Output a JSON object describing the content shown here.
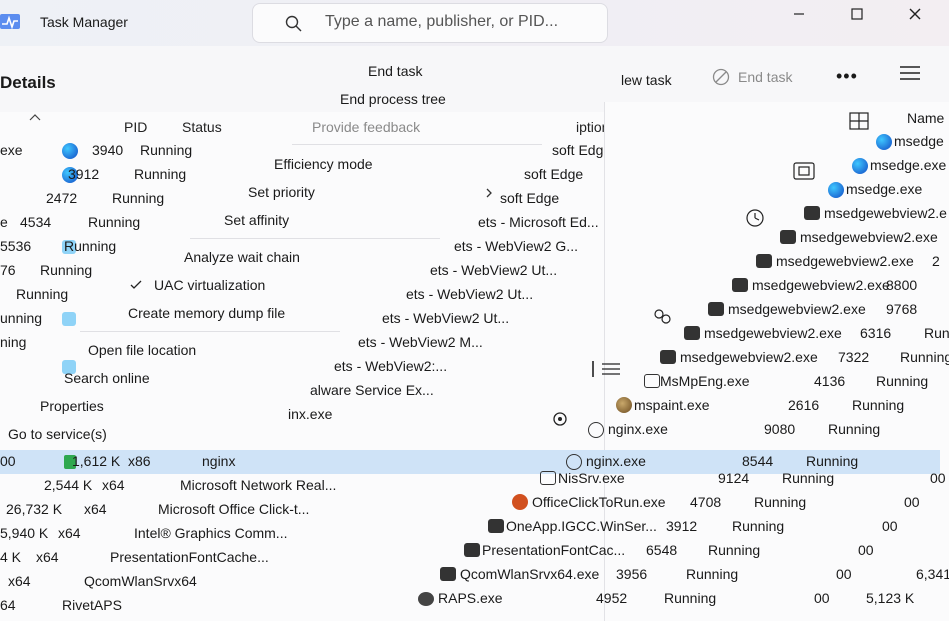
{
  "app": {
    "title": "Task Manager"
  },
  "search": {
    "placeholder": "Type a name, publisher, or PID..."
  },
  "window_controls": {
    "minimize": "—",
    "maximize": "☐",
    "close": "✕"
  },
  "commandbar": {
    "page_title": "Details",
    "run_new_task": "lew task",
    "end_task": "End task",
    "more": "•••"
  },
  "left_table": {
    "headers": {
      "pid": "PID",
      "status": "Status",
      "desc": "iption"
    },
    "rows": [
      {
        "name": "exe",
        "pid": "3940",
        "status": "Running",
        "desc": "soft Edge"
      },
      {
        "name": "",
        "pid": "3912",
        "status": "Running",
        "desc": "soft Edge"
      },
      {
        "name": "",
        "pid": "2472",
        "status": "Running",
        "desc": "soft Edge"
      },
      {
        "name": "e",
        "pid": "4534",
        "status": "Running",
        "desc": "ets - Microsoft Ed..."
      },
      {
        "name": "",
        "pid": "5536",
        "status": "Running",
        "desc": "ets - WebView2 G..."
      },
      {
        "name": "76",
        "pid": "",
        "status": "Running",
        "desc": "ets - WebView2 Ut..."
      },
      {
        "name": "",
        "pid": "",
        "status": "Running",
        "desc": "ets - WebView2 Ut..."
      },
      {
        "name": "",
        "pid": "",
        "status": "unning",
        "desc": "ets - WebView2 Ut..."
      },
      {
        "name": "",
        "pid": "",
        "status": "ning",
        "desc": "ets - WebView2 M..."
      },
      {
        "name": "",
        "pid": "",
        "status": "",
        "desc": "ets - WebView2:..."
      },
      {
        "name": "",
        "pid": "",
        "status": "",
        "desc": "alware Service Ex..."
      },
      {
        "name": "",
        "pid": "",
        "status": "",
        "desc": "inx.exe"
      }
    ],
    "lower_rows": [
      {
        "mem": "00",
        "mem2": "1,612 K",
        "arch": "x86",
        "desc": "nginx"
      },
      {
        "mem": "",
        "mem2": "2,544 K",
        "arch": "x64",
        "desc": "Microsoft Network Real..."
      },
      {
        "mem": "",
        "mem2": "26,732 K",
        "arch": "x64",
        "desc": "Microsoft Office Click-t..."
      },
      {
        "mem": "",
        "mem2": "5,940 K",
        "arch": "x64",
        "desc": "Intel® Graphics Comm..."
      },
      {
        "mem": "",
        "mem2": "4 K",
        "arch": "x64",
        "desc": "PresentationFontCache..."
      },
      {
        "mem": "",
        "mem2": "",
        "arch": "x64",
        "desc": "QcomWlanSrvx64"
      },
      {
        "mem": "",
        "mem2": "",
        "arch": "64",
        "desc": "RivetAPS"
      }
    ]
  },
  "context_menu": {
    "items": [
      {
        "label": "End task"
      },
      {
        "label": "End process tree"
      },
      {
        "label": "Provide feedback",
        "disabled": true
      },
      {
        "label": "Efficiency mode"
      },
      {
        "label": "Set priority"
      },
      {
        "label": "Set affinity"
      },
      {
        "label": "Analyze wait chain"
      },
      {
        "label": "UAC virtualization",
        "checked": true
      },
      {
        "label": "Create memory dump file"
      },
      {
        "label": "Open file location"
      },
      {
        "label": "Search online"
      },
      {
        "label": "Properties"
      },
      {
        "label": "Go to service(s)"
      }
    ]
  },
  "right_window": {
    "header_name": "Name",
    "rows": [
      {
        "name": "msedge",
        "pid": "",
        "status": ""
      },
      {
        "name": "msedge.exe",
        "pid": "",
        "status": ""
      },
      {
        "name": "msedge.exe",
        "pid": "",
        "status": ""
      },
      {
        "name": "msedgewebview2.e",
        "pid": "",
        "status": ""
      },
      {
        "name": "msedgewebview2.exe",
        "pid": "",
        "status": ""
      },
      {
        "name": "msedgewebview2.exe",
        "pid": "2",
        "status": ""
      },
      {
        "name": "msedgewebview2.exe",
        "pid": "8800",
        "status": ""
      },
      {
        "name": "msedgewebview2.exe",
        "pid": "9768",
        "status": ""
      },
      {
        "name": "msedgewebview2.exe",
        "pid": "6316",
        "status": "Runi"
      },
      {
        "name": "msedgewebview2.exe",
        "pid": "7322",
        "status": "Running"
      },
      {
        "name": "MsMpEng.exe",
        "pid": "4136",
        "status": "Running"
      },
      {
        "name": "mspaint.exe",
        "pid": "2616",
        "status": "Running"
      },
      {
        "name": "nginx.exe",
        "pid": "9080",
        "status": "Running"
      },
      {
        "name": "nginx.exe",
        "pid": "8544",
        "status": "Running"
      },
      {
        "name": "NisSrv.exe",
        "pid": "9124",
        "status": "Running",
        "extra": "00"
      },
      {
        "name": "OfficeClickToRun.exe",
        "pid": "4708",
        "status": "Running",
        "extra": "00"
      },
      {
        "name": "OneApp.IGCC.WinSer...",
        "pid": "3912",
        "status": "Running",
        "extra": "00"
      },
      {
        "name": "PresentationFontCac...",
        "pid": "6548",
        "status": "Running",
        "extra": "00"
      },
      {
        "name": "QcomWlanSrvx64.exe",
        "pid": "3956",
        "status": "Running",
        "extra": "00",
        "mem": "6,341"
      },
      {
        "name": "RAPS.exe",
        "pid": "4952",
        "status": "Running",
        "extra": "00",
        "mem": "5,123 K"
      }
    ]
  },
  "colors": {
    "selection": "#cfe3f7",
    "edge_blue": "#1f6fd6",
    "disabled": "#8a8a8a"
  }
}
